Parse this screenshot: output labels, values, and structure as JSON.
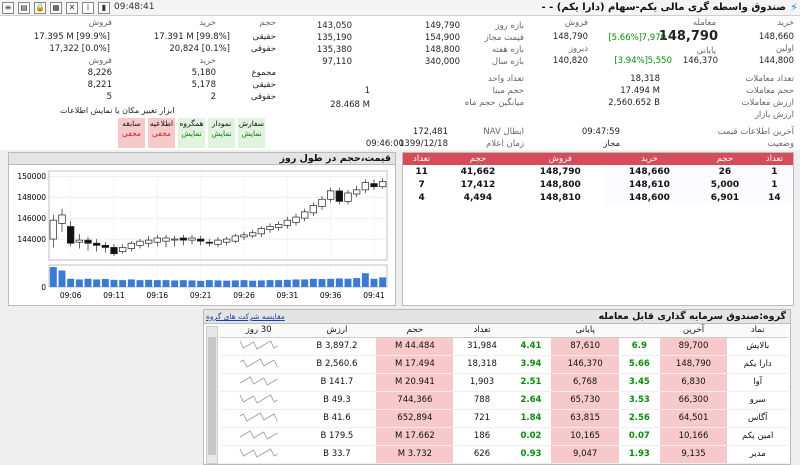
{
  "toolbar": {
    "time": "09:48:41",
    "title": "صندوق واسطه گری مالی یکم-سهام (دارا یکم)",
    "title_suffix": "- -"
  },
  "quote": {
    "trade_label": "معامله",
    "trade_price": "148,790",
    "trade_change": "7,970",
    "trade_pct": "[5.66%]",
    "close_label": "پایانی",
    "close_price": "146,370",
    "close_change": "5,550",
    "close_pct": "[3.94%]",
    "buy_label": "خرید",
    "buy_price": "148,660",
    "sell_label": "فروش",
    "sell_price": "148,790",
    "first_label": "اولین",
    "first_price": "144,800",
    "yesterday_label": "دیروز",
    "yesterday_price": "140,820",
    "count_label": "تعداد معاملات",
    "count_value": "18,318",
    "volume_label": "حجم معاملات",
    "volume_value": "17.494 M",
    "value_label": "ارزش معاملات",
    "value_value": "2,560.652 B",
    "market_value_label": "ارزش بازار",
    "last_info_label": "آخرین اطلاعات قیمت",
    "last_info_value": "09:47:59",
    "status_label": "وضعیت",
    "status_value": "مجاز"
  },
  "ranges": {
    "day_label": "بازه روز",
    "day_low": "143,050",
    "day_high": "149,790",
    "allowed_label": "قیمت مجاز",
    "allowed_low": "135,190",
    "allowed_high": "154,900",
    "week_label": "بازه هفته",
    "week_low": "135,380",
    "week_high": "148,800",
    "year_label": "بازه سال",
    "year_low": "97,110",
    "year_high": "340,000",
    "unit_label": "تعداد واحد",
    "base_label": "حجم مبنا",
    "base_value": "1",
    "avg_label": "میانگین حجم ماه",
    "avg_value": "28.468 M",
    "nav_label": "NAV ابطال",
    "nav_value": "172,481",
    "notice_label": "زمان اعلام",
    "notice_date": "1399/12/18",
    "notice_time": "09:46:00"
  },
  "client": {
    "col_buy": "خرید",
    "col_sell": "فروش",
    "col_volume": "حجم",
    "real_label": "حقیقی",
    "real_buy": "17.391 M [99.8%]",
    "real_sell": "17.395 M [99.9%]",
    "legal_label": "حقوقی",
    "legal_buy": "20,824 [0.1%]",
    "legal_sell": "17,322 [0.0%]",
    "count_buy": "خرید",
    "count_sell": "فروش",
    "sum_label": "مجموع",
    "sum_buy": "5,180",
    "sum_sell": "8,226",
    "real2_label": "حقیقی",
    "real2_buy": "5,178",
    "real2_sell": "8,221",
    "legal2_label": "حقوقی",
    "legal2_buy": "2",
    "legal2_sell": "5"
  },
  "buttons": {
    "caption": "ابزار تغییر مکان یا نمایش اطلاعات",
    "items": [
      {
        "l1": "سفارش",
        "l2": "نمایش"
      },
      {
        "l1": "نمودار",
        "l2": "نمایش"
      },
      {
        "l1": "همگروه",
        "l2": "نمایش"
      },
      {
        "l1": "اطلاعیه",
        "l2": "مخفی"
      },
      {
        "l1": "سابقه",
        "l2": "مخفی"
      }
    ]
  },
  "chart_panel": {
    "title": "قیمت،حجم در طول روز"
  },
  "chart_data": {
    "type": "candlestick",
    "times": [
      "09:04",
      "09:05",
      "09:06",
      "09:07",
      "09:08",
      "09:09",
      "09:10",
      "09:11",
      "09:12",
      "09:13",
      "09:14",
      "09:15",
      "09:16",
      "09:17",
      "09:18",
      "09:19",
      "09:20",
      "09:21",
      "09:22",
      "09:23",
      "09:24",
      "09:25",
      "09:26",
      "09:27",
      "09:28",
      "09:29",
      "09:30",
      "09:31",
      "09:32",
      "09:33",
      "09:34",
      "09:35",
      "09:36",
      "09:37",
      "09:38",
      "09:39",
      "09:40",
      "09:41",
      "09:42"
    ],
    "candles": [
      [
        144000,
        145800,
        143200,
        146300
      ],
      [
        145500,
        146300,
        144700,
        146900
      ],
      [
        145200,
        143600,
        143300,
        145700
      ],
      [
        143700,
        143900,
        143100,
        144500
      ],
      [
        143900,
        143600,
        142900,
        144200
      ],
      [
        143600,
        143400,
        142800,
        144000
      ],
      [
        143400,
        143200,
        142700,
        143700
      ],
      [
        143200,
        142600,
        142400,
        143500
      ],
      [
        142800,
        143200,
        142600,
        143500
      ],
      [
        143100,
        143600,
        142800,
        143800
      ],
      [
        143400,
        143800,
        143100,
        144000
      ],
      [
        143600,
        143900,
        143200,
        144300
      ],
      [
        143700,
        144100,
        143300,
        144400
      ],
      [
        143800,
        144100,
        143200,
        144400
      ],
      [
        144000,
        144000,
        143300,
        144300
      ],
      [
        144100,
        143900,
        143400,
        144400
      ],
      [
        143900,
        144100,
        143500,
        144400
      ],
      [
        144000,
        143800,
        143400,
        144300
      ],
      [
        143700,
        143600,
        143300,
        144000
      ],
      [
        143500,
        143900,
        143200,
        144200
      ],
      [
        143700,
        144000,
        143400,
        144200
      ],
      [
        143800,
        144300,
        143600,
        144500
      ],
      [
        144200,
        144400,
        143900,
        144700
      ],
      [
        144300,
        144600,
        144100,
        144900
      ],
      [
        144500,
        145000,
        144200,
        145200
      ],
      [
        144900,
        145200,
        144600,
        145500
      ],
      [
        145100,
        145400,
        144800,
        145700
      ],
      [
        145300,
        145800,
        145000,
        146100
      ],
      [
        145600,
        146100,
        145300,
        146400
      ],
      [
        146000,
        146600,
        145700,
        146900
      ],
      [
        146500,
        147200,
        146200,
        147500
      ],
      [
        147100,
        147800,
        146800,
        148100
      ],
      [
        147800,
        148600,
        147500,
        148900
      ],
      [
        148600,
        147600,
        147300,
        148900
      ],
      [
        147600,
        148400,
        147300,
        148700
      ],
      [
        148300,
        148700,
        148000,
        149100
      ],
      [
        148700,
        149400,
        148400,
        149700
      ],
      [
        149300,
        149000,
        148700,
        149700
      ],
      [
        149000,
        149500,
        148800,
        149800
      ]
    ],
    "volume": [
      1.45,
      1.2,
      0.6,
      0.55,
      0.6,
      0.55,
      0.58,
      0.52,
      0.5,
      0.55,
      0.5,
      0.52,
      0.5,
      0.5,
      0.48,
      0.5,
      0.48,
      0.45,
      0.5,
      0.48,
      0.46,
      0.48,
      0.5,
      0.46,
      0.48,
      0.5,
      0.5,
      0.52,
      0.55,
      0.55,
      0.6,
      0.58,
      0.6,
      0.62,
      0.6,
      0.65,
      1.0,
      0.6,
      0.7
    ],
    "y_ticks": [
      "150000",
      "148000",
      "146000",
      "144000"
    ],
    "vol_tick": "0",
    "x_ticks": [
      "09:06",
      "09:11",
      "09:16",
      "09:21",
      "09:26",
      "09:31",
      "09:36",
      "09:41"
    ],
    "ylim": [
      142000,
      150500
    ],
    "vlim": [
      0,
      1.6
    ]
  },
  "orderbook": {
    "headers": [
      "تعداد",
      "حجم",
      "خرید",
      "فروش",
      "حجم",
      "تعداد"
    ],
    "rows": [
      [
        "1",
        "26",
        "148,660",
        "148,790",
        "41,662",
        "11"
      ],
      [
        "1",
        "5,000",
        "148,610",
        "148,800",
        "17,412",
        "7"
      ],
      [
        "14",
        "6,901",
        "148,600",
        "148,810",
        "4,494",
        "4"
      ]
    ]
  },
  "group": {
    "title": "گروه:صندوق سرمایه گذاری قابل معامله",
    "compare_link": "مقایسه شرکت های گروه",
    "headers": [
      "نماد",
      "آخرین",
      "",
      "پایانی",
      "",
      "تعداد",
      "حجم",
      "ارزش",
      "30 روز"
    ],
    "rows": [
      [
        "بالایش",
        "89,700",
        "6.9",
        "87,610",
        "4.41",
        "31,984",
        "44.484 M",
        "3,897.2 B"
      ],
      [
        "دارا یکم",
        "148,790",
        "5.66",
        "146,370",
        "3.94",
        "18,318",
        "17.494 M",
        "2,560.6 B"
      ],
      [
        "آوا",
        "6,830",
        "3.45",
        "6,768",
        "2.51",
        "1,903",
        "20.941 M",
        "141.7 B"
      ],
      [
        "سرو",
        "66,300",
        "3.53",
        "65,730",
        "2.64",
        "788",
        "744,366",
        "49.3 B"
      ],
      [
        "آگاس",
        "64,501",
        "2.56",
        "63,815",
        "1.84",
        "721",
        "652,894",
        "41.6 B"
      ],
      [
        "امین یکم",
        "10,166",
        "0.07",
        "10,165",
        "0.02",
        "186",
        "17.662 M",
        "179.5 B"
      ],
      [
        "مدیر",
        "9,135",
        "1.93",
        "9,047",
        "0.93",
        "626",
        "3.732 M",
        "33.7 B"
      ]
    ]
  }
}
